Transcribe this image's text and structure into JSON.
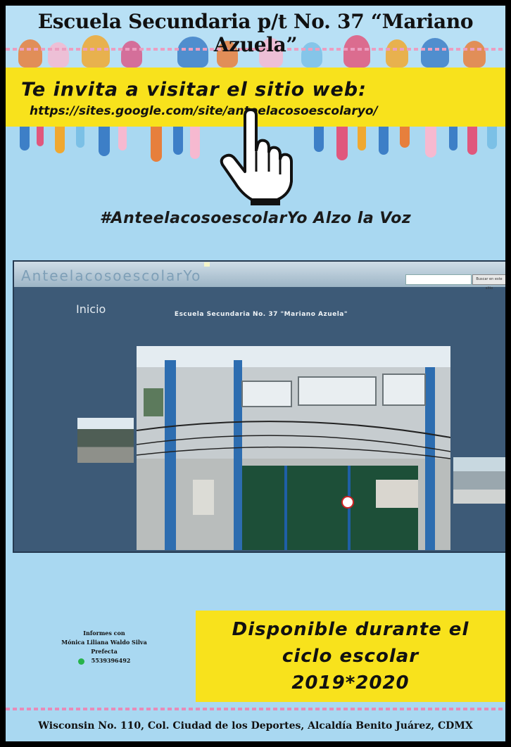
{
  "header": {
    "school_name": "Escuela Secundaria p/t No. 37 “Mariano Azuela”"
  },
  "invite": {
    "line1": "Te invita a visitar el sitio web:",
    "url": "https://sites.google.com/site/anteelacosoescolaryo/"
  },
  "hashtag": "#AnteelacosoescolarYo Alzo la Voz",
  "site_preview": {
    "logo": "AnteelacosoescolarYo",
    "page_heading": "Inicio",
    "page_subtitle": "Escuela Secundaria No. 37 \"Mariano Azuela\"",
    "search_button": "Buscar en este sitio"
  },
  "contact": {
    "line1": "Informes con",
    "name": "Mónica Liliana Waldo Silva",
    "role": "Prefecta",
    "phone": "5539396492",
    "phone_icon": "whatsapp-icon"
  },
  "availability": {
    "line1": "Disponible durante el",
    "line2": "ciclo escolar",
    "line3": "2019*2020"
  },
  "footer": {
    "address": "Wisconsin No. 110, Col. Ciudad de los Deportes, Alcaldía Benito Juárez, CDMX"
  },
  "colors": {
    "background": "#a9d8f1",
    "highlight": "#f8e21c",
    "frame": "#000000"
  }
}
